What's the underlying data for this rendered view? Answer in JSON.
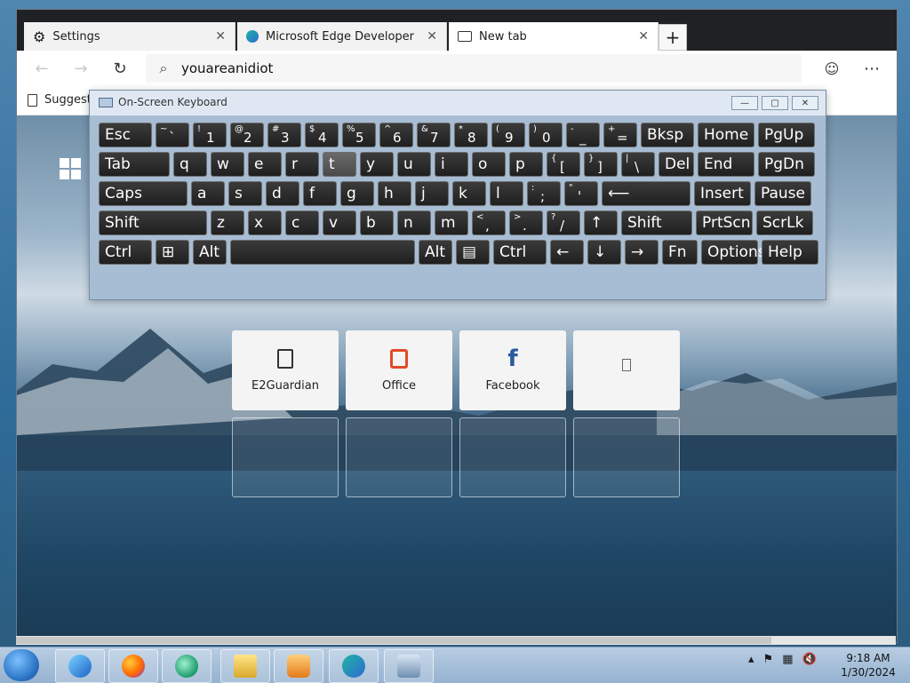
{
  "browser": {
    "tabs": [
      {
        "label": "Settings",
        "icon": "gear-icon",
        "active": false
      },
      {
        "label": "Microsoft Edge Developer",
        "icon": "edge-icon",
        "active": false
      },
      {
        "label": "New tab",
        "icon": "newtab-icon",
        "active": true
      }
    ],
    "new_tab_symbol": "+",
    "omnibox": {
      "value": "youareanidiot"
    },
    "favorites_bar": {
      "first_item": "Suggest"
    }
  },
  "new_tab_page": {
    "tiles": [
      {
        "label": "E2Guardian",
        "icon": "document-icon"
      },
      {
        "label": "Office",
        "icon": "office-icon"
      },
      {
        "label": "Facebook",
        "icon": "facebook-icon"
      },
      {
        "label": "",
        "icon": "blank-icon"
      }
    ]
  },
  "osk": {
    "title": "On-Screen Keyboard",
    "rows": [
      [
        {
          "k": "Esc"
        },
        {
          "sup": "~",
          "main": "`"
        },
        {
          "sup": "!",
          "main": "1"
        },
        {
          "sup": "@",
          "main": "2"
        },
        {
          "sup": "#",
          "main": "3"
        },
        {
          "sup": "$",
          "main": "4"
        },
        {
          "sup": "%",
          "main": "5"
        },
        {
          "sup": "^",
          "main": "6"
        },
        {
          "sup": "&",
          "main": "7"
        },
        {
          "sup": "*",
          "main": "8"
        },
        {
          "sup": "(",
          "main": "9"
        },
        {
          "sup": ")",
          "main": "0"
        },
        {
          "sup": "-",
          "main": "_"
        },
        {
          "sup": "+",
          "main": "="
        },
        {
          "k": "Bksp"
        },
        {
          "k": "Home"
        },
        {
          "k": "PgUp"
        }
      ],
      [
        {
          "k": "Tab"
        },
        {
          "k": "q"
        },
        {
          "k": "w"
        },
        {
          "k": "e"
        },
        {
          "k": "r"
        },
        {
          "k": "t"
        },
        {
          "k": "y"
        },
        {
          "k": "u"
        },
        {
          "k": "i"
        },
        {
          "k": "o"
        },
        {
          "k": "p"
        },
        {
          "sup": "{",
          "main": "["
        },
        {
          "sup": "}",
          "main": "]"
        },
        {
          "sup": "|",
          "main": "\\"
        },
        {
          "k": "Del"
        },
        {
          "k": "End"
        },
        {
          "k": "PgDn"
        }
      ],
      [
        {
          "k": "Caps"
        },
        {
          "k": "a"
        },
        {
          "k": "s"
        },
        {
          "k": "d"
        },
        {
          "k": "f"
        },
        {
          "k": "g"
        },
        {
          "k": "h"
        },
        {
          "k": "j"
        },
        {
          "k": "k"
        },
        {
          "k": "l"
        },
        {
          "sup": ":",
          "main": ";"
        },
        {
          "sup": "\"",
          "main": "'"
        },
        {
          "k": "⟵"
        },
        {
          "k": "Insert"
        },
        {
          "k": "Pause"
        }
      ],
      [
        {
          "k": "Shift"
        },
        {
          "k": "z"
        },
        {
          "k": "x"
        },
        {
          "k": "c"
        },
        {
          "k": "v"
        },
        {
          "k": "b"
        },
        {
          "k": "n"
        },
        {
          "k": "m"
        },
        {
          "sup": "<",
          "main": ","
        },
        {
          "sup": ">",
          "main": "."
        },
        {
          "sup": "?",
          "main": "/"
        },
        {
          "k": "↑"
        },
        {
          "k": "Shift"
        },
        {
          "k": "PrtScn"
        },
        {
          "k": "ScrLk"
        }
      ],
      [
        {
          "k": "Ctrl"
        },
        {
          "k": "⊞"
        },
        {
          "k": "Alt"
        },
        {
          "k": ""
        },
        {
          "k": "Alt"
        },
        {
          "k": "▤"
        },
        {
          "k": "Ctrl"
        },
        {
          "k": "←"
        },
        {
          "k": "↓"
        },
        {
          "k": "→"
        },
        {
          "k": "Fn"
        },
        {
          "k": "Options"
        },
        {
          "k": "Help"
        }
      ]
    ]
  },
  "taskbar": {
    "clock_time": "9:18 AM",
    "clock_date": "1/30/2024"
  }
}
